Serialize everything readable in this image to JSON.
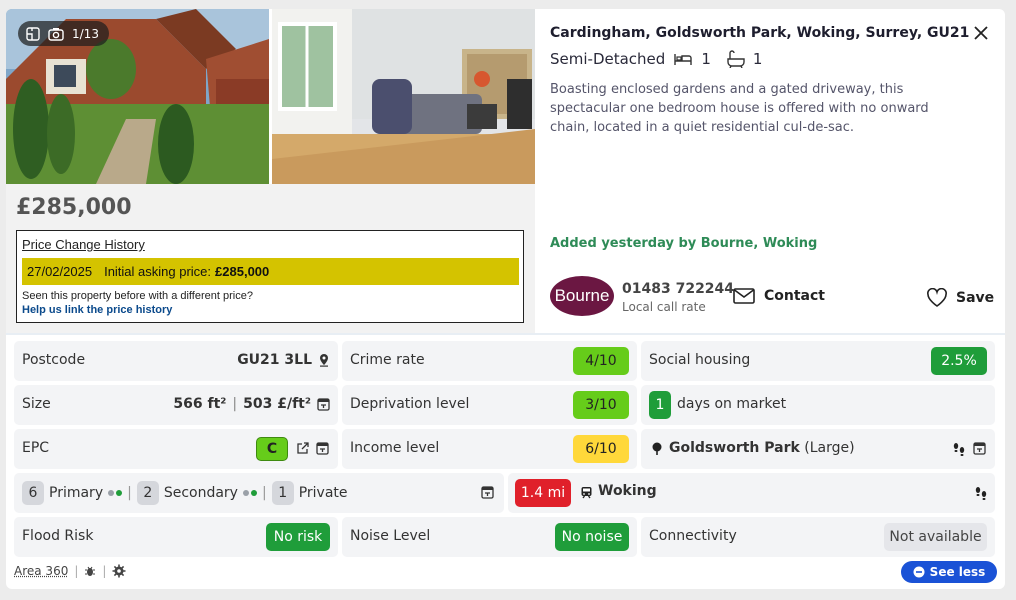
{
  "photos": {
    "counter": "1/13",
    "icons": [
      "floorplan-icon",
      "camera-icon"
    ]
  },
  "price": "£285,000",
  "price_history": {
    "title": "Price Change History",
    "date": "27/02/2025",
    "event": "Initial asking price:",
    "amount": "£285,000",
    "note": "Seen this property before with a different price?",
    "link": "Help us link the price history"
  },
  "listing": {
    "address": "Cardingham, Goldsworth Park, Woking, Surrey, GU21",
    "type": "Semi-Detached",
    "bedrooms": "1",
    "bathrooms": "1",
    "description": "Boasting enclosed gardens and a gated driveway, this spectacular one bedroom house is offered with no onward chain, located in a quiet residential cul-de-sac.",
    "added": "Added yesterday by Bourne, Woking"
  },
  "agent": {
    "logo_text": "Bourne",
    "phone": "01483 722244",
    "phone_note": "Local call rate",
    "contact_label": "Contact",
    "save_label": "Save"
  },
  "details": {
    "postcode_label": "Postcode",
    "postcode": "GU21 3LL",
    "crime_label": "Crime rate",
    "crime": "4/10",
    "social_label": "Social housing",
    "social": "2.5%",
    "size_label": "Size",
    "size_ft": "566 ft²",
    "size_sep": "|",
    "size_price": "503 £/ft²",
    "deprivation_label": "Deprivation level",
    "deprivation": "3/10",
    "days_count": "1",
    "days_label": "days on market",
    "epc_label": "EPC",
    "epc": "C",
    "income_label": "Income level",
    "income": "6/10",
    "area_name": "Goldsworth Park",
    "area_size": "(Large)",
    "schools_primary_count": "6",
    "schools_primary": "Primary",
    "schools_secondary_count": "2",
    "schools_secondary": "Secondary",
    "schools_private_count": "1",
    "schools_private": "Private",
    "station_distance": "1.4 mi",
    "station_name": "Woking",
    "flood_label": "Flood Risk",
    "flood": "No risk",
    "noise_label": "Noise Level",
    "noise": "No noise",
    "connectivity_label": "Connectivity",
    "connectivity": "Not available"
  },
  "footer": {
    "area360": "Area 360",
    "sep": "|",
    "see_less": "See less"
  },
  "colors": {
    "green": "#1f9d3a",
    "light_green": "#66cc1a",
    "yellow": "#ffd83a",
    "red": "#e0202a",
    "blue": "#1a52d6",
    "agent_brand": "#6b1742",
    "history_highlight": "#d4c300"
  }
}
